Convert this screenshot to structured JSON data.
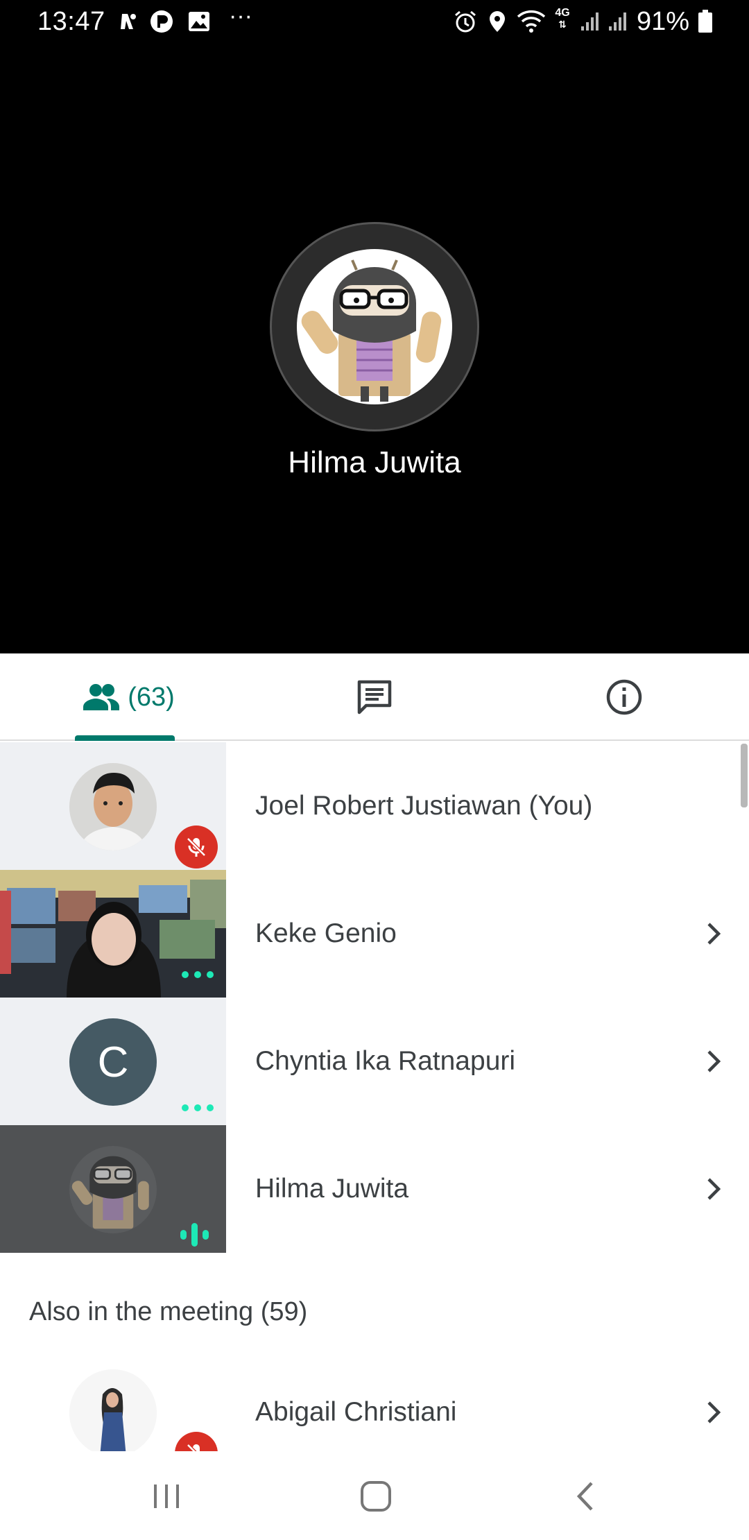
{
  "status_bar": {
    "time": "13:47",
    "network": "4G",
    "battery": "91%"
  },
  "stage": {
    "active_speaker": "Hilma Juwita"
  },
  "tabs": {
    "people_count": "(63)"
  },
  "participants": [
    {
      "name": "Joel Robert Justiawan (You)",
      "muted": true
    },
    {
      "name": "Keke Genio",
      "status": "connecting"
    },
    {
      "name": "Chyntia Ika Ratnapuri",
      "initial": "C",
      "status": "connecting"
    },
    {
      "name": "Hilma Juwita",
      "status": "speaking"
    }
  ],
  "also_in_meeting": {
    "label": "Also in the meeting (59)",
    "first": {
      "name": "Abigail Christiani",
      "muted": true
    }
  },
  "colors": {
    "accent": "#00796b",
    "mute_red": "#d93025",
    "activity": "#1de9b6"
  }
}
